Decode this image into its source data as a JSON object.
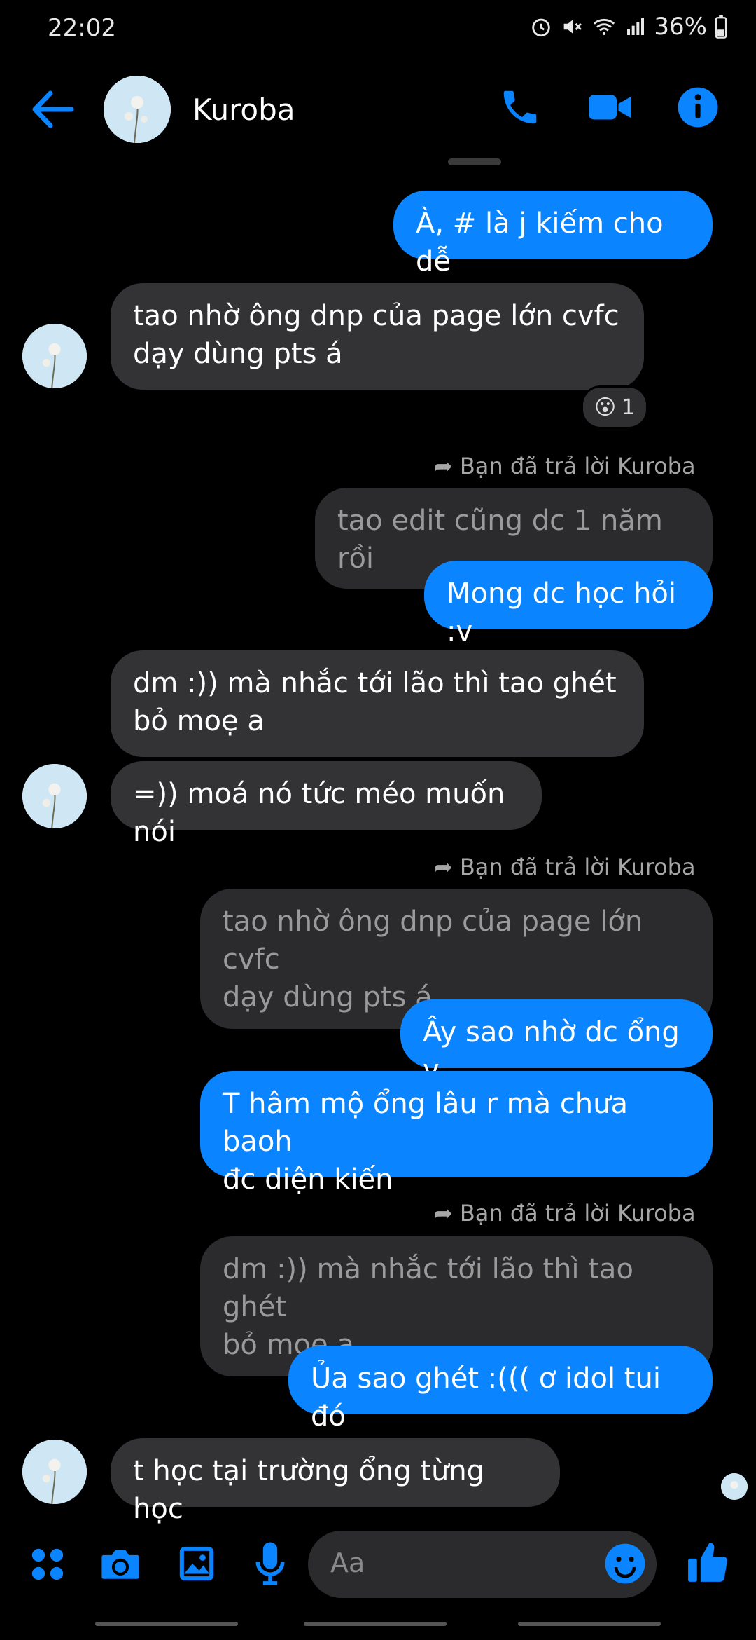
{
  "status": {
    "time": "22:02",
    "battery": "36%"
  },
  "header": {
    "contact_name": "Kuroba"
  },
  "messages": {
    "m1": "À, # là j kiếm cho dễ",
    "m2_line1": "tao nhờ ông dnp của page lớn cvfc",
    "m2_line2": "dạy dùng pts á",
    "reaction_count": "1",
    "reply_note_1": "Bạn đã trả lời Kuroba",
    "quote1": "tao edit cũng dc 1 năm rồi",
    "m3": "Mong dc học hỏi :v",
    "m4_line1": "dm :)) mà nhắc tới lão thì tao ghét",
    "m4_line2": "bỏ moẹ a",
    "m5": "=)) moá nó tức méo muốn nói",
    "reply_note_2": "Bạn đã trả lời Kuroba",
    "quote2_line1": "tao nhờ ông dnp của page lớn cvfc",
    "quote2_line2": "dạy dùng pts á",
    "m6": "Ây sao nhờ dc ổng v",
    "m7_line1": "T hâm mộ ổng lâu r mà chưa baoh",
    "m7_line2": "đc diện kiến",
    "reply_note_3": "Bạn đã trả lời Kuroba",
    "quote3_line1": "dm :)) mà nhắc tới lão thì tao ghét",
    "quote3_line2": "bỏ moẹ a",
    "m8": "Ủa sao ghét :((( ơ idol tui đó",
    "m9": "t học tại trường ổng từng học"
  },
  "composer": {
    "placeholder": "Aa"
  },
  "colors": {
    "accent": "#0a84ff",
    "incoming": "#333336",
    "quoted": "#2b2b2d",
    "background": "#000000"
  },
  "icons": [
    "back-arrow-icon",
    "phone-icon",
    "video-camera-icon",
    "info-icon",
    "apps-icon",
    "camera-icon",
    "gallery-icon",
    "microphone-icon",
    "emoji-icon",
    "thumbs-up-icon"
  ]
}
